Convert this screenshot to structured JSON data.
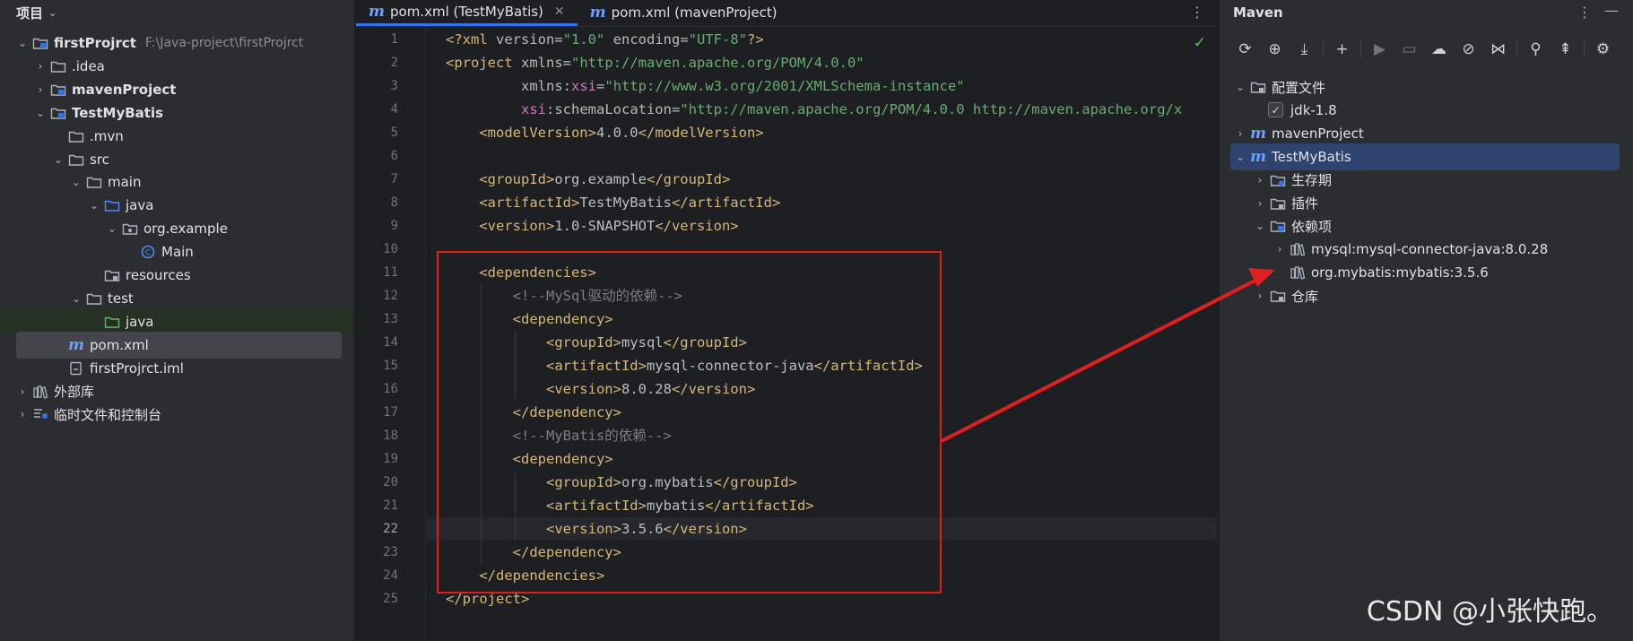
{
  "project": {
    "title": "项目",
    "tree": [
      {
        "label": "firstProjrct",
        "path": "F:\\Java-project\\firstProjrct",
        "arrow": "down",
        "icon": "module-folder-icon",
        "bold": true,
        "indent": 0
      },
      {
        "label": ".idea",
        "arrow": "right",
        "icon": "folder-icon",
        "bold": false,
        "indent": 1
      },
      {
        "label": "mavenProject",
        "arrow": "right",
        "icon": "module-folder-icon",
        "bold": true,
        "indent": 1
      },
      {
        "label": "TestMyBatis",
        "arrow": "down",
        "icon": "module-folder-icon",
        "bold": true,
        "indent": 1
      },
      {
        "label": ".mvn",
        "arrow": "",
        "icon": "folder-icon",
        "bold": false,
        "indent": 2
      },
      {
        "label": "src",
        "arrow": "down",
        "icon": "folder-icon",
        "bold": false,
        "indent": 2
      },
      {
        "label": "main",
        "arrow": "down",
        "icon": "folder-icon",
        "bold": false,
        "indent": 3
      },
      {
        "label": "java",
        "arrow": "down",
        "icon": "source-folder-icon",
        "bold": false,
        "indent": 4
      },
      {
        "label": "org.example",
        "arrow": "down",
        "icon": "package-icon",
        "bold": false,
        "indent": 5
      },
      {
        "label": "Main",
        "arrow": "",
        "icon": "class-icon",
        "bold": false,
        "indent": 6
      },
      {
        "label": "resources",
        "arrow": "",
        "icon": "resources-folder-icon",
        "bold": false,
        "indent": 4
      },
      {
        "label": "test",
        "arrow": "down",
        "icon": "folder-icon",
        "bold": false,
        "indent": 3
      },
      {
        "label": "java",
        "arrow": "",
        "icon": "test-folder-icon",
        "bold": false,
        "indent": 4
      },
      {
        "label": "pom.xml",
        "arrow": "",
        "icon": "maven-file-icon",
        "bold": false,
        "indent": 2
      },
      {
        "label": "firstProjrct.iml",
        "arrow": "",
        "icon": "iml-file-icon",
        "bold": false,
        "indent": 2
      },
      {
        "label": "外部库",
        "arrow": "right",
        "icon": "library-icon",
        "bold": false,
        "indent": 0
      },
      {
        "label": "临时文件和控制台",
        "arrow": "right",
        "icon": "scratch-icon",
        "bold": false,
        "indent": 0
      }
    ]
  },
  "editor": {
    "tabs": [
      {
        "label": "pom.xml (TestMyBatis)",
        "active": true
      },
      {
        "label": "pom.xml (mavenProject)",
        "active": false
      }
    ],
    "current_line": 22,
    "lines": [
      [
        [
          "t-tag",
          "<?xml "
        ],
        [
          "t-attr",
          "version="
        ],
        [
          "t-str",
          "\"1.0\""
        ],
        [
          "t-attr",
          " encoding="
        ],
        [
          "t-str",
          "\"UTF-8\""
        ],
        [
          "t-tag",
          "?>"
        ]
      ],
      [
        [
          "t-tag",
          "<project "
        ],
        [
          "t-attr",
          "xmlns="
        ],
        [
          "t-str",
          "\"http://maven.apache.org/POM/4.0.0\""
        ]
      ],
      [
        [
          "t-attr",
          "         xmlns"
        ],
        [
          "t-txt",
          ":"
        ],
        [
          "t-ns",
          "xsi"
        ],
        [
          "t-txt",
          "="
        ],
        [
          "t-str",
          "\"http://www.w3.org/2001/XMLSchema-instance\""
        ]
      ],
      [
        [
          "t-ns",
          "         xsi"
        ],
        [
          "t-txt",
          ":"
        ],
        [
          "t-attr",
          "schemaLocation="
        ],
        [
          "t-str",
          "\"http://maven.apache.org/POM/4.0.0 http://maven.apache.org/x"
        ]
      ],
      [
        [
          "t-tag",
          "    <modelVersion>"
        ],
        [
          "t-txt",
          "4.0.0"
        ],
        [
          "t-tag",
          "</modelVersion>"
        ]
      ],
      [],
      [
        [
          "t-tag",
          "    <groupId>"
        ],
        [
          "t-txt",
          "org.example"
        ],
        [
          "t-tag",
          "</groupId>"
        ]
      ],
      [
        [
          "t-tag",
          "    <artifactId>"
        ],
        [
          "t-txt",
          "TestMyBatis"
        ],
        [
          "t-tag",
          "</artifactId>"
        ]
      ],
      [
        [
          "t-tag",
          "    <version>"
        ],
        [
          "t-txt",
          "1.0-SNAPSHOT"
        ],
        [
          "t-tag",
          "</version>"
        ]
      ],
      [],
      [
        [
          "t-tag",
          "    <dependencies>"
        ]
      ],
      [
        [
          "t-cmt",
          "        <!--MySql驱动的依赖-->"
        ]
      ],
      [
        [
          "t-tag",
          "        <dependency>"
        ]
      ],
      [
        [
          "t-tag",
          "            <groupId>"
        ],
        [
          "t-txt",
          "mysql"
        ],
        [
          "t-tag",
          "</groupId>"
        ]
      ],
      [
        [
          "t-tag",
          "            <artifactId>"
        ],
        [
          "t-txt",
          "mysql-connector-java"
        ],
        [
          "t-tag",
          "</artifactId>"
        ]
      ],
      [
        [
          "t-tag",
          "            <version>"
        ],
        [
          "t-txt",
          "8.0.28"
        ],
        [
          "t-tag",
          "</version>"
        ]
      ],
      [
        [
          "t-tag",
          "        </dependency>"
        ]
      ],
      [
        [
          "t-cmt",
          "        <!--MyBatis的依赖-->"
        ]
      ],
      [
        [
          "t-tag",
          "        <dependency>"
        ]
      ],
      [
        [
          "t-tag",
          "            <groupId>"
        ],
        [
          "t-txt",
          "org.mybatis"
        ],
        [
          "t-tag",
          "</groupId>"
        ]
      ],
      [
        [
          "t-tag",
          "            <artifactId>"
        ],
        [
          "t-txt",
          "mybatis"
        ],
        [
          "t-tag",
          "</artifactId>"
        ]
      ],
      [
        [
          "t-tag",
          "            <version>"
        ],
        [
          "t-txt",
          "3.5.6"
        ],
        [
          "t-tag",
          "</version>"
        ]
      ],
      [
        [
          "t-tag",
          "        </dependency>"
        ]
      ],
      [
        [
          "t-tag",
          "    </dependencies>"
        ]
      ],
      [
        [
          "t-tag",
          "</project>"
        ]
      ]
    ]
  },
  "maven": {
    "title": "Maven",
    "tree": [
      {
        "label": "配置文件",
        "arrow": "down",
        "icon": "profiles-folder-icon",
        "indent": 0
      },
      {
        "label": "jdk-1.8",
        "arrow": "",
        "icon": "checkbox",
        "indent": 1
      },
      {
        "label": "mavenProject",
        "arrow": "right",
        "icon": "maven-icon",
        "indent": 0
      },
      {
        "label": "TestMyBatis",
        "arrow": "down",
        "icon": "maven-icon",
        "indent": 0
      },
      {
        "label": "生存期",
        "arrow": "right",
        "icon": "lifecycle-folder-icon",
        "indent": 1
      },
      {
        "label": "插件",
        "arrow": "right",
        "icon": "plugins-folder-icon",
        "indent": 1
      },
      {
        "label": "依赖项",
        "arrow": "down",
        "icon": "dependencies-folder-icon",
        "indent": 1
      },
      {
        "label": "mysql:mysql-connector-java:8.0.28",
        "arrow": "right",
        "icon": "library-icon",
        "indent": 2
      },
      {
        "label": "org.mybatis:mybatis:3.5.6",
        "arrow": "",
        "icon": "library-icon",
        "indent": 2
      },
      {
        "label": "仓库",
        "arrow": "right",
        "icon": "repository-folder-icon",
        "indent": 1
      }
    ],
    "toolbar": [
      "reload-icon",
      "add-folder-icon",
      "download-icon",
      "sep",
      "plus-icon",
      "sep",
      "run-icon",
      "execute-goal-icon",
      "offline-icon",
      "skip-tests-icon",
      "collapse-icon",
      "sep",
      "analyze-icon",
      "expand-all-icon",
      "sep",
      "settings-icon"
    ]
  },
  "watermark": "CSDN @小张快跑。"
}
